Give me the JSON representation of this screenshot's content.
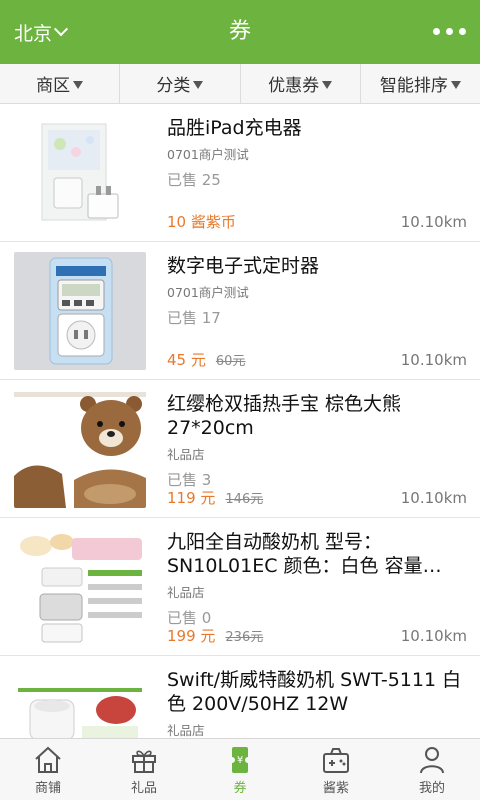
{
  "header": {
    "city": "北京",
    "title": "券"
  },
  "filters": [
    {
      "label": "商区"
    },
    {
      "label": "分类"
    },
    {
      "label": "优惠券"
    },
    {
      "label": "智能排序"
    }
  ],
  "products": [
    {
      "name": "品胜iPad充电器",
      "shop": "0701商户测试",
      "sold": "已售 25",
      "price": "10 酱紫币",
      "original_price": "",
      "distance": "10.10km",
      "image": "charger"
    },
    {
      "name": "数字电子式定时器",
      "shop": "0701商户测试",
      "sold": "已售 17",
      "price": "45 元",
      "original_price": "60元",
      "distance": "10.10km",
      "image": "timer"
    },
    {
      "name": "红缨枪双插热手宝 棕色大熊 27*20cm",
      "shop": "礼品店",
      "sold": "已售 3",
      "price": "119 元",
      "original_price": "146元",
      "distance": "10.10km",
      "image": "bear-warmer"
    },
    {
      "name": "九阳全自动酸奶机 型号：SN10L01EC 颜色：白色 容量…",
      "shop": "礼品店",
      "sold": "已售 0",
      "price": "199 元",
      "original_price": "236元",
      "distance": "10.10km",
      "image": "yogurt-maker"
    },
    {
      "name": "Swift/斯威特酸奶机 SWT-5111 白色 200V/50HZ 12W",
      "shop": "礼品店",
      "sold": "",
      "price": "",
      "original_price": "",
      "distance": "",
      "image": "yogurt-machine"
    }
  ],
  "tabs": [
    {
      "label": "商铺",
      "icon": "house-icon"
    },
    {
      "label": "礼品",
      "icon": "gift-icon"
    },
    {
      "label": "券",
      "icon": "coupon-icon",
      "active": true
    },
    {
      "label": "酱紫",
      "icon": "gamepad-icon"
    },
    {
      "label": "我的",
      "icon": "person-icon"
    }
  ],
  "colors": {
    "brand": "#6db33f",
    "price": "#e8792c"
  }
}
